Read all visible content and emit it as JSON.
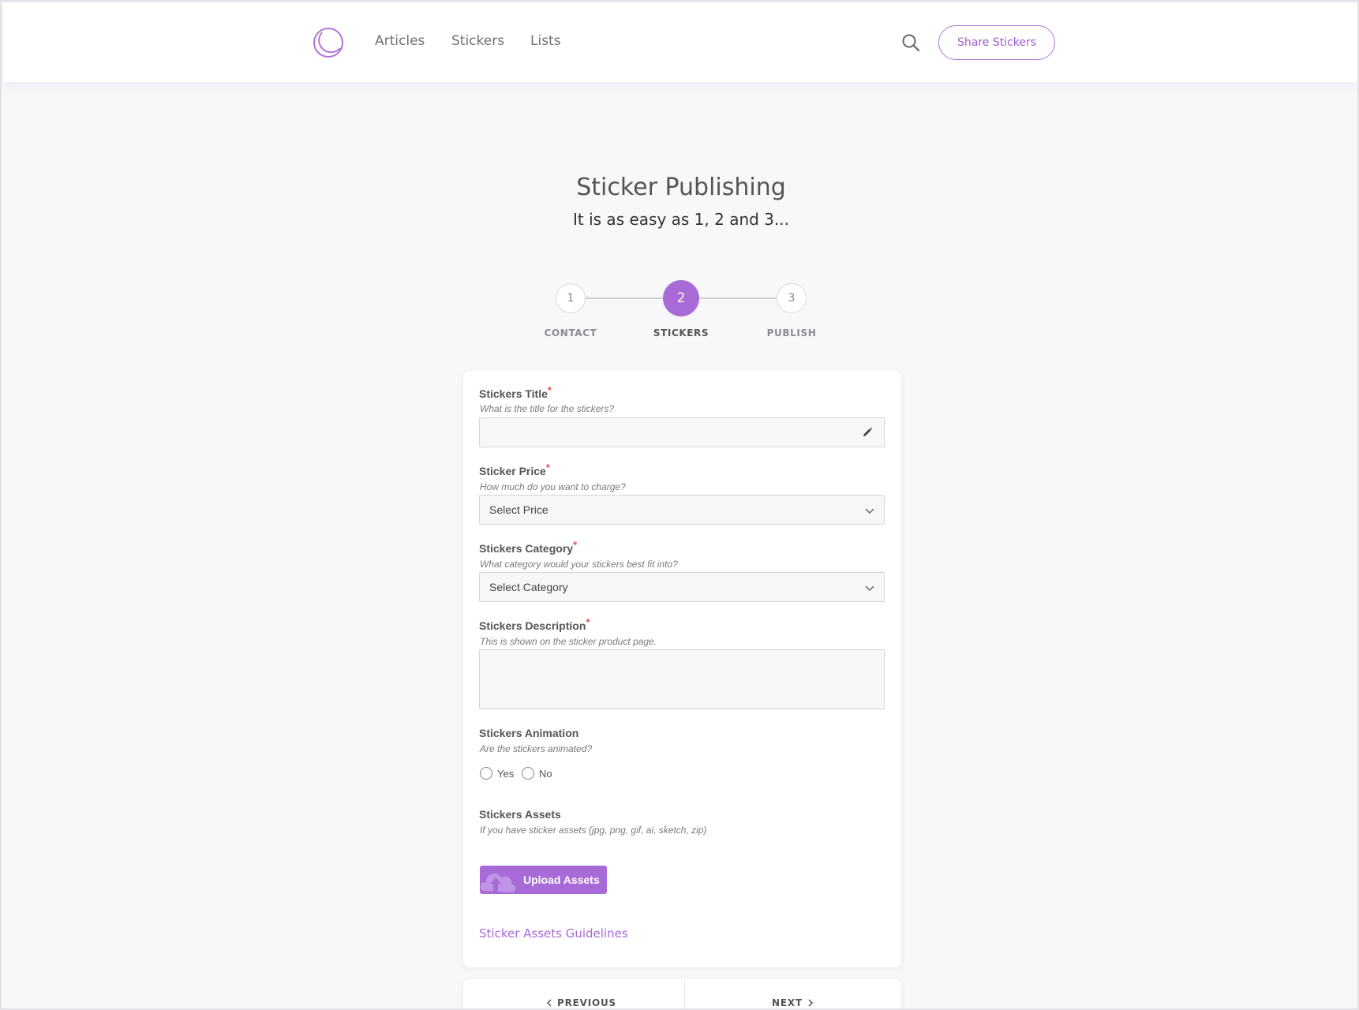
{
  "header": {
    "nav": [
      "Articles",
      "Stickers",
      "Lists"
    ],
    "share_label": "Share Stickers"
  },
  "hero": {
    "title": "Sticker Publishing",
    "subtitle": "It is as easy as 1, 2 and 3..."
  },
  "stepper": {
    "steps": [
      {
        "number": "1",
        "label": "CONTACT"
      },
      {
        "number": "2",
        "label": "STICKERS"
      },
      {
        "number": "3",
        "label": "PUBLISH"
      }
    ],
    "active_step": 2
  },
  "form": {
    "title_field": {
      "label": "Stickers Title",
      "hint": "What is the title for the stickers?",
      "value": ""
    },
    "price_field": {
      "label": "Sticker Price",
      "hint": "How much do you want to charge?",
      "selected": "Select Price"
    },
    "category_field": {
      "label": "Stickers Category",
      "hint": "What category would your stickers best fit into?",
      "selected": "Select Category"
    },
    "description_field": {
      "label": "Stickers Description",
      "hint": "This is shown on the sticker product page.",
      "value": ""
    },
    "animation_field": {
      "label": "Stickers Animation",
      "hint": "Are the stickers animated?",
      "options": [
        "Yes",
        "No"
      ]
    },
    "assets_field": {
      "label": "Stickers Assets",
      "hint": "If you have sticker assets (jpg, png, gif, ai, sketch, zip)"
    },
    "required_mark": "*",
    "upload_label": "Upload Assets",
    "guidelines_link": "Sticker Assets Guidelines"
  },
  "pager": {
    "previous_label": "PREVIOUS",
    "next_label": "NEXT"
  },
  "colors": {
    "accent": "#a86ad6",
    "required": "#e05252",
    "background": "#f8f8fa"
  },
  "icons": [
    "sticker-logo-icon",
    "search-icon",
    "pencil-icon",
    "chevron-down-icon",
    "cloud-upload-icon",
    "chevron-left-icon",
    "chevron-right-icon"
  ]
}
